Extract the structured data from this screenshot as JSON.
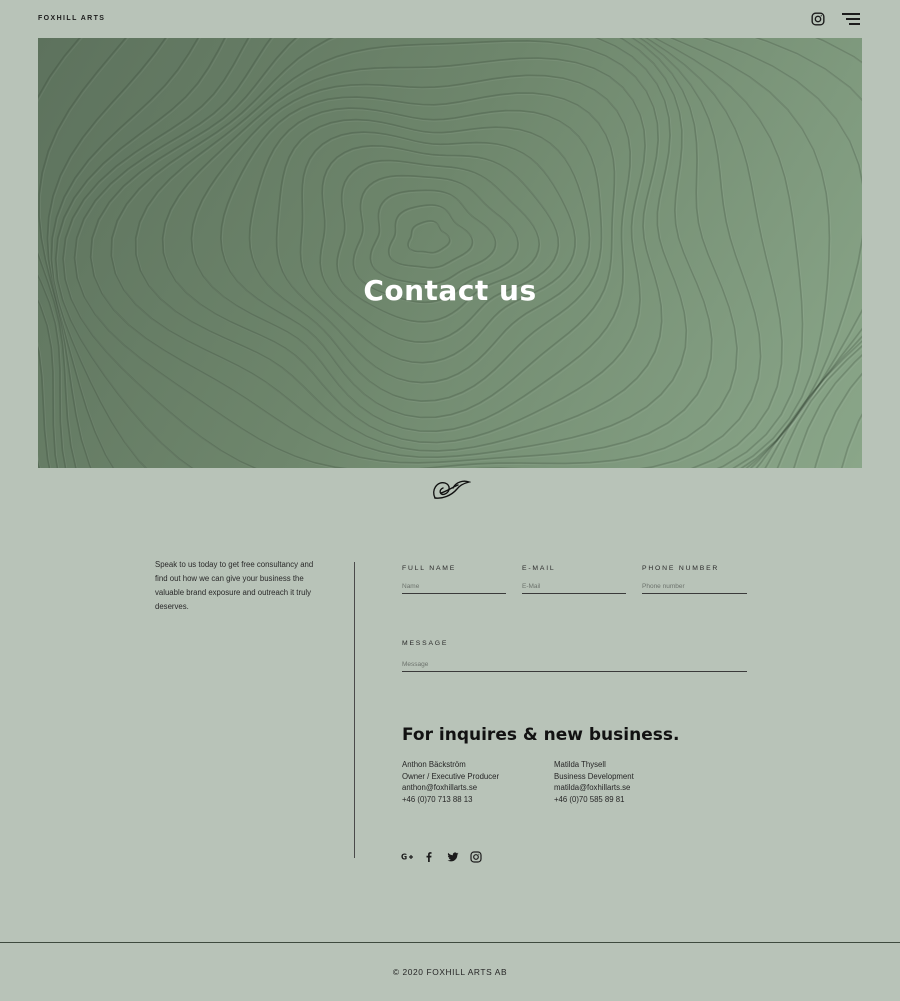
{
  "header": {
    "brand": "FOXHILL ARTS",
    "instagram_icon": "instagram-icon",
    "menu_icon": "hamburger-menu-icon"
  },
  "hero": {
    "title": "Contact us"
  },
  "divider_icon": "leaf-logo-icon",
  "intro": {
    "text": "Speak to us today to get free consultancy and find out how we can give your business the valuable brand exposure and outreach it truly deserves."
  },
  "form": {
    "full_name": {
      "label": "FULL NAME",
      "placeholder": "Name",
      "value": ""
    },
    "email": {
      "label": "E-MAIL",
      "placeholder": "E-Mail",
      "value": ""
    },
    "phone": {
      "label": "PHONE NUMBER",
      "placeholder": "Phone number",
      "value": ""
    },
    "message": {
      "label": "MESSAGE",
      "placeholder": "Message",
      "value": ""
    }
  },
  "inquiries": {
    "heading": "For inquires & new business.",
    "contacts": [
      {
        "name": "Anthon Bäckström",
        "role": "Owner / Executive Producer",
        "email": "anthon@foxhillarts.se",
        "phone": "+46 (0)70 713 88 13"
      },
      {
        "name": "Matilda Thysell",
        "role": "Business Development",
        "email": "matilda@foxhillarts.se",
        "phone": "+46 (0)70 585 89 81"
      }
    ]
  },
  "social": {
    "icons": [
      "google-plus-icon",
      "facebook-icon",
      "twitter-icon",
      "instagram-icon"
    ]
  },
  "footer": {
    "copyright": "© 2020 FOXHILL ARTS AB"
  },
  "colors": {
    "background": "#b8c3b8",
    "hero_green": "#6e866c",
    "text": "#1c1c1c"
  }
}
